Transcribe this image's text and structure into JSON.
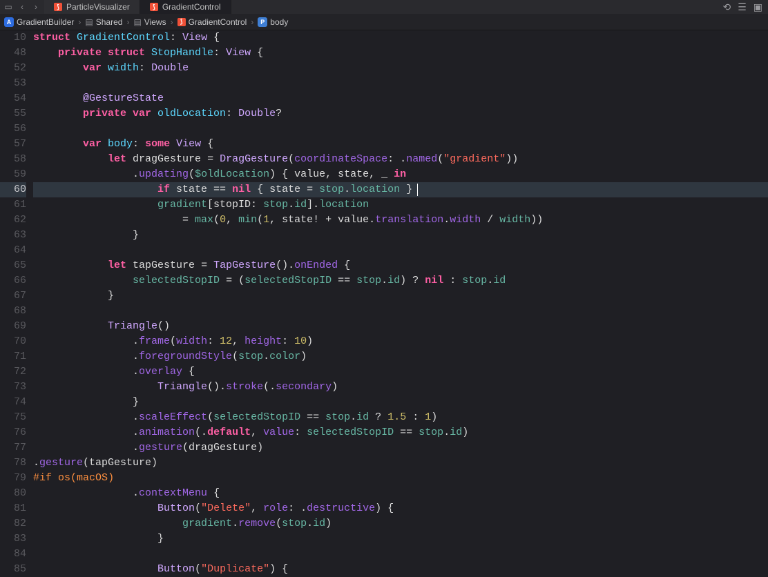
{
  "tabs": [
    {
      "name": "ParticleVisualizer",
      "active": false
    },
    {
      "name": "GradientControl",
      "active": true
    }
  ],
  "breadcrumb": {
    "app": "GradientBuilder",
    "folder1": "Shared",
    "folder2": "Views",
    "struct": "GradientControl",
    "prop": "body"
  },
  "sticky_lines": [
    {
      "num": "10",
      "kw1": "struct",
      "type": "GradientControl",
      "colon": ":",
      "proto": "View",
      "brace": " {"
    },
    {
      "num": "48",
      "indent": "    ",
      "kw1": "private",
      "kw2": "struct",
      "type": "StopHandle",
      "colon": ":",
      "proto": "View",
      "brace": " {"
    }
  ],
  "lines": [
    {
      "num": "52",
      "seg": [
        {
          "t": "        ",
          "c": "plain"
        },
        {
          "t": "var ",
          "c": "kw"
        },
        {
          "t": "width",
          "c": "decl"
        },
        {
          "t": ": ",
          "c": "pun"
        },
        {
          "t": "Double",
          "c": "type"
        }
      ]
    },
    {
      "num": "53",
      "seg": []
    },
    {
      "num": "54",
      "seg": [
        {
          "t": "        ",
          "c": "plain"
        },
        {
          "t": "@GestureState",
          "c": "type"
        }
      ]
    },
    {
      "num": "55",
      "seg": [
        {
          "t": "        ",
          "c": "plain"
        },
        {
          "t": "private ",
          "c": "kw"
        },
        {
          "t": "var ",
          "c": "kw"
        },
        {
          "t": "oldLocation",
          "c": "decl"
        },
        {
          "t": ": ",
          "c": "pun"
        },
        {
          "t": "Double",
          "c": "type"
        },
        {
          "t": "?",
          "c": "pun"
        }
      ]
    },
    {
      "num": "56",
      "seg": []
    },
    {
      "num": "57",
      "seg": [
        {
          "t": "        ",
          "c": "plain"
        },
        {
          "t": "var ",
          "c": "kw"
        },
        {
          "t": "body",
          "c": "decl"
        },
        {
          "t": ": ",
          "c": "pun"
        },
        {
          "t": "some ",
          "c": "kw"
        },
        {
          "t": "View",
          "c": "type"
        },
        {
          "t": " {",
          "c": "pun"
        }
      ]
    },
    {
      "num": "58",
      "seg": [
        {
          "t": "            ",
          "c": "plain"
        },
        {
          "t": "let ",
          "c": "kw"
        },
        {
          "t": "dragGesture",
          "c": "plain"
        },
        {
          "t": " = ",
          "c": "op"
        },
        {
          "t": "DragGesture",
          "c": "type"
        },
        {
          "t": "(",
          "c": "pun"
        },
        {
          "t": "coordinateSpace",
          "c": "param"
        },
        {
          "t": ": .",
          "c": "pun"
        },
        {
          "t": "named",
          "c": "func"
        },
        {
          "t": "(",
          "c": "pun"
        },
        {
          "t": "\"gradient\"",
          "c": "str"
        },
        {
          "t": "))",
          "c": "pun"
        }
      ]
    },
    {
      "num": "59",
      "seg": [
        {
          "t": "                .",
          "c": "pun"
        },
        {
          "t": "updating",
          "c": "func"
        },
        {
          "t": "(",
          "c": "pun"
        },
        {
          "t": "$oldLocation",
          "c": "prop"
        },
        {
          "t": ") { value, state, _ ",
          "c": "plain"
        },
        {
          "t": "in",
          "c": "kw"
        }
      ]
    },
    {
      "num": "60",
      "hl": true,
      "cursor": 556,
      "seg": [
        {
          "t": "                    ",
          "c": "plain"
        },
        {
          "t": "if ",
          "c": "kw"
        },
        {
          "t": "state == ",
          "c": "plain"
        },
        {
          "t": "nil",
          "c": "kw"
        },
        {
          "t": " { state = ",
          "c": "plain"
        },
        {
          "t": "stop",
          "c": "prop"
        },
        {
          "t": ".",
          "c": "pun"
        },
        {
          "t": "location",
          "c": "prop"
        },
        {
          "t": " }",
          "c": "pun"
        }
      ]
    },
    {
      "num": "61",
      "seg": [
        {
          "t": "                    ",
          "c": "plain"
        },
        {
          "t": "gradient",
          "c": "prop"
        },
        {
          "t": "[stopID: ",
          "c": "plain"
        },
        {
          "t": "stop",
          "c": "prop"
        },
        {
          "t": ".",
          "c": "pun"
        },
        {
          "t": "id",
          "c": "prop"
        },
        {
          "t": "].",
          "c": "pun"
        },
        {
          "t": "location",
          "c": "prop"
        }
      ]
    },
    {
      "num": "62",
      "seg": [
        {
          "t": "                        = ",
          "c": "plain"
        },
        {
          "t": "max",
          "c": "funcG"
        },
        {
          "t": "(",
          "c": "pun"
        },
        {
          "t": "0",
          "c": "num"
        },
        {
          "t": ", ",
          "c": "pun"
        },
        {
          "t": "min",
          "c": "funcG"
        },
        {
          "t": "(",
          "c": "pun"
        },
        {
          "t": "1",
          "c": "num"
        },
        {
          "t": ", state! + value.",
          "c": "plain"
        },
        {
          "t": "translation",
          "c": "func"
        },
        {
          "t": ".",
          "c": "pun"
        },
        {
          "t": "width",
          "c": "func"
        },
        {
          "t": " / ",
          "c": "plain"
        },
        {
          "t": "width",
          "c": "prop"
        },
        {
          "t": "))",
          "c": "pun"
        }
      ]
    },
    {
      "num": "63",
      "seg": [
        {
          "t": "                }",
          "c": "pun"
        }
      ]
    },
    {
      "num": "64",
      "seg": []
    },
    {
      "num": "65",
      "seg": [
        {
          "t": "            ",
          "c": "plain"
        },
        {
          "t": "let ",
          "c": "kw"
        },
        {
          "t": "tapGesture",
          "c": "plain"
        },
        {
          "t": " = ",
          "c": "op"
        },
        {
          "t": "TapGesture",
          "c": "type"
        },
        {
          "t": "().",
          "c": "pun"
        },
        {
          "t": "onEnded",
          "c": "func"
        },
        {
          "t": " {",
          "c": "pun"
        }
      ]
    },
    {
      "num": "66",
      "seg": [
        {
          "t": "                ",
          "c": "plain"
        },
        {
          "t": "selectedStopID",
          "c": "prop"
        },
        {
          "t": " = (",
          "c": "plain"
        },
        {
          "t": "selectedStopID",
          "c": "prop"
        },
        {
          "t": " == ",
          "c": "plain"
        },
        {
          "t": "stop",
          "c": "prop"
        },
        {
          "t": ".",
          "c": "pun"
        },
        {
          "t": "id",
          "c": "prop"
        },
        {
          "t": ") ? ",
          "c": "plain"
        },
        {
          "t": "nil",
          "c": "kw"
        },
        {
          "t": " : ",
          "c": "plain"
        },
        {
          "t": "stop",
          "c": "prop"
        },
        {
          "t": ".",
          "c": "pun"
        },
        {
          "t": "id",
          "c": "prop"
        }
      ]
    },
    {
      "num": "67",
      "seg": [
        {
          "t": "            }",
          "c": "pun"
        }
      ]
    },
    {
      "num": "68",
      "seg": []
    },
    {
      "num": "69",
      "seg": [
        {
          "t": "            ",
          "c": "plain"
        },
        {
          "t": "Triangle",
          "c": "type"
        },
        {
          "t": "()",
          "c": "pun"
        }
      ]
    },
    {
      "num": "70",
      "seg": [
        {
          "t": "                .",
          "c": "pun"
        },
        {
          "t": "frame",
          "c": "func"
        },
        {
          "t": "(",
          "c": "pun"
        },
        {
          "t": "width",
          "c": "param"
        },
        {
          "t": ": ",
          "c": "pun"
        },
        {
          "t": "12",
          "c": "num"
        },
        {
          "t": ", ",
          "c": "pun"
        },
        {
          "t": "height",
          "c": "param"
        },
        {
          "t": ": ",
          "c": "pun"
        },
        {
          "t": "10",
          "c": "num"
        },
        {
          "t": ")",
          "c": "pun"
        }
      ]
    },
    {
      "num": "71",
      "seg": [
        {
          "t": "                .",
          "c": "pun"
        },
        {
          "t": "foregroundStyle",
          "c": "func"
        },
        {
          "t": "(",
          "c": "pun"
        },
        {
          "t": "stop",
          "c": "prop"
        },
        {
          "t": ".",
          "c": "pun"
        },
        {
          "t": "color",
          "c": "prop"
        },
        {
          "t": ")",
          "c": "pun"
        }
      ]
    },
    {
      "num": "72",
      "seg": [
        {
          "t": "                .",
          "c": "pun"
        },
        {
          "t": "overlay",
          "c": "func"
        },
        {
          "t": " {",
          "c": "pun"
        }
      ]
    },
    {
      "num": "73",
      "seg": [
        {
          "t": "                    ",
          "c": "plain"
        },
        {
          "t": "Triangle",
          "c": "type"
        },
        {
          "t": "().",
          "c": "pun"
        },
        {
          "t": "stroke",
          "c": "func"
        },
        {
          "t": "(.",
          "c": "pun"
        },
        {
          "t": "secondary",
          "c": "func"
        },
        {
          "t": ")",
          "c": "pun"
        }
      ]
    },
    {
      "num": "74",
      "seg": [
        {
          "t": "                }",
          "c": "pun"
        }
      ]
    },
    {
      "num": "75",
      "seg": [
        {
          "t": "                .",
          "c": "pun"
        },
        {
          "t": "scaleEffect",
          "c": "func"
        },
        {
          "t": "(",
          "c": "pun"
        },
        {
          "t": "selectedStopID",
          "c": "prop"
        },
        {
          "t": " == ",
          "c": "plain"
        },
        {
          "t": "stop",
          "c": "prop"
        },
        {
          "t": ".",
          "c": "pun"
        },
        {
          "t": "id",
          "c": "prop"
        },
        {
          "t": " ? ",
          "c": "plain"
        },
        {
          "t": "1.5",
          "c": "num"
        },
        {
          "t": " : ",
          "c": "plain"
        },
        {
          "t": "1",
          "c": "num"
        },
        {
          "t": ")",
          "c": "pun"
        }
      ]
    },
    {
      "num": "76",
      "seg": [
        {
          "t": "                .",
          "c": "pun"
        },
        {
          "t": "animation",
          "c": "func"
        },
        {
          "t": "(.",
          "c": "pun"
        },
        {
          "t": "default",
          "c": "kw"
        },
        {
          "t": ", ",
          "c": "pun"
        },
        {
          "t": "value",
          "c": "param"
        },
        {
          "t": ": ",
          "c": "pun"
        },
        {
          "t": "selectedStopID",
          "c": "prop"
        },
        {
          "t": " == ",
          "c": "plain"
        },
        {
          "t": "stop",
          "c": "prop"
        },
        {
          "t": ".",
          "c": "pun"
        },
        {
          "t": "id",
          "c": "prop"
        },
        {
          "t": ")",
          "c": "pun"
        }
      ]
    },
    {
      "num": "77",
      "seg": [
        {
          "t": "                .",
          "c": "pun"
        },
        {
          "t": "gesture",
          "c": "func"
        },
        {
          "t": "(dragGesture)",
          "c": "plain"
        }
      ]
    },
    {
      "num": "78",
      "seg": [
        {
          "t": ".",
          "c": "pun"
        },
        {
          "t": "gesture",
          "c": "func"
        },
        {
          "t": "(tapGesture)",
          "c": "plain"
        }
      ]
    },
    {
      "num": "79",
      "seg": [
        {
          "t": "#if ",
          "c": "preproc"
        },
        {
          "t": "os",
          "c": "preproc"
        },
        {
          "t": "(",
          "c": "preproc"
        },
        {
          "t": "macOS",
          "c": "preproc"
        },
        {
          "t": ")",
          "c": "preproc"
        }
      ]
    },
    {
      "num": "80",
      "seg": [
        {
          "t": "                .",
          "c": "pun"
        },
        {
          "t": "contextMenu",
          "c": "func"
        },
        {
          "t": " {",
          "c": "pun"
        }
      ]
    },
    {
      "num": "81",
      "seg": [
        {
          "t": "                    ",
          "c": "plain"
        },
        {
          "t": "Button",
          "c": "type"
        },
        {
          "t": "(",
          "c": "pun"
        },
        {
          "t": "\"Delete\"",
          "c": "str"
        },
        {
          "t": ", ",
          "c": "pun"
        },
        {
          "t": "role",
          "c": "param"
        },
        {
          "t": ": .",
          "c": "pun"
        },
        {
          "t": "destructive",
          "c": "func"
        },
        {
          "t": ") {",
          "c": "pun"
        }
      ]
    },
    {
      "num": "82",
      "seg": [
        {
          "t": "                        ",
          "c": "plain"
        },
        {
          "t": "gradient",
          "c": "prop"
        },
        {
          "t": ".",
          "c": "pun"
        },
        {
          "t": "remove",
          "c": "func"
        },
        {
          "t": "(",
          "c": "pun"
        },
        {
          "t": "stop",
          "c": "prop"
        },
        {
          "t": ".",
          "c": "pun"
        },
        {
          "t": "id",
          "c": "prop"
        },
        {
          "t": ")",
          "c": "pun"
        }
      ]
    },
    {
      "num": "83",
      "seg": [
        {
          "t": "                    }",
          "c": "pun"
        }
      ]
    },
    {
      "num": "84",
      "seg": []
    },
    {
      "num": "85",
      "seg": [
        {
          "t": "                    ",
          "c": "plain"
        },
        {
          "t": "Button",
          "c": "type"
        },
        {
          "t": "(",
          "c": "pun"
        },
        {
          "t": "\"Duplicate\"",
          "c": "str"
        },
        {
          "t": ") {",
          "c": "pun"
        }
      ]
    }
  ]
}
